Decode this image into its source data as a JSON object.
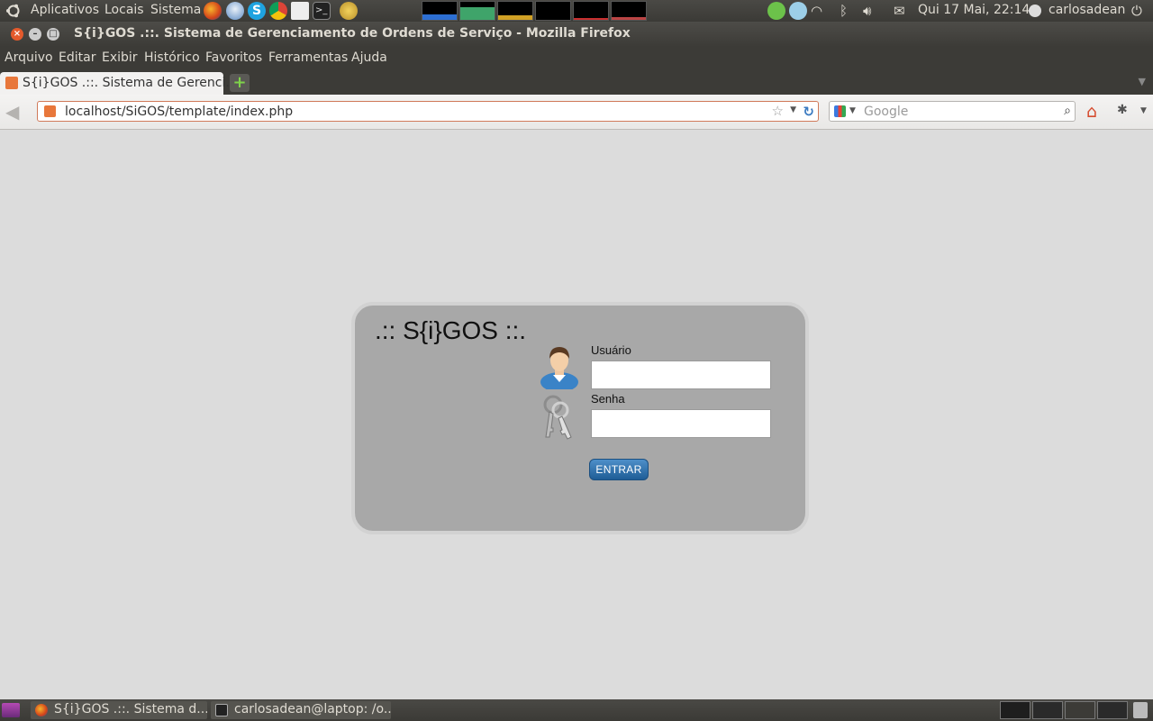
{
  "top_panel": {
    "menus": [
      "Aplicativos",
      "Locais",
      "Sistema"
    ],
    "clock": "Qui 17 Mai, 22:14",
    "user": "carlosadean",
    "launchers": [
      "firefox-icon",
      "thunderbird-icon",
      "skype-icon",
      "chrome-icon",
      "text-editor-icon",
      "terminal-icon",
      "pidgin-icon"
    ],
    "tray_icons": [
      "messenger-icon",
      "network-status-icon",
      "wifi-icon",
      "bluetooth-icon",
      "volume-icon",
      "mail-icon",
      "power-icon"
    ]
  },
  "window": {
    "title": "S{i}GOS .::. Sistema de Gerenciamento de Ordens de Serviço - Mozilla Firefox"
  },
  "menubar": {
    "items": [
      "Arquivo",
      "Editar",
      "Exibir",
      "Histórico",
      "Favoritos",
      "Ferramentas",
      "Ajuda"
    ]
  },
  "tabs": [
    {
      "label": "S{i}GOS .::. Sistema de Gerenci...",
      "active": true
    }
  ],
  "navbar": {
    "url": "localhost/SiGOS/template/index.php",
    "search_placeholder": "Google"
  },
  "login": {
    "title": ".:: S{i}GOS ::.",
    "username_label": "Usuário",
    "username_value": "",
    "password_label": "Senha",
    "password_value": "",
    "submit_label": "ENTRAR"
  },
  "taskbar": {
    "tasks": [
      {
        "label": "S{i}GOS .::. Sistema d...",
        "icon": "firefox-icon"
      },
      {
        "label": "carlosadean@laptop: /o...",
        "icon": "terminal-icon"
      }
    ]
  },
  "colors": {
    "page_background": "#dcdcdc",
    "login_box": "#a8a8a8",
    "button_blue": "#2c6da8",
    "panel": "#3c3b37"
  }
}
